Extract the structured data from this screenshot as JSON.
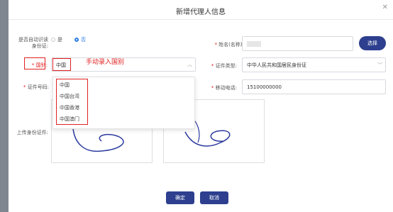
{
  "dialog": {
    "title": "新增代理人信息",
    "close_icon": "close-icon"
  },
  "auto_read": {
    "label": "是否自动识读身份证:",
    "line1": "是否自动识读",
    "line2": "身份证:",
    "option_yes": "是",
    "option_no": "否",
    "selected": "否"
  },
  "nationality": {
    "label": "国别:",
    "value": "中国",
    "options": [
      "中国",
      "中国台湾",
      "中国香港",
      "中国澳门"
    ]
  },
  "annotation": {
    "text": "手动录入国别"
  },
  "name": {
    "label": "姓名(名称):",
    "value": ""
  },
  "select_button": {
    "label": "选择"
  },
  "id_type": {
    "label": "证件类型:",
    "value": "中华人民共和国居民身份证"
  },
  "id_number": {
    "label": "证件号码:",
    "value": ""
  },
  "phone": {
    "label": "移动电话:",
    "value": "15100000000"
  },
  "upload": {
    "label": "上传身份证件:"
  },
  "footer": {
    "confirm_label": "确定",
    "cancel_label": "取消"
  },
  "colors": {
    "primary": "#2d3f8e",
    "annotation_red": "#e02020",
    "radio_blue": "#2c7be5",
    "overlay": "#7f8690"
  }
}
